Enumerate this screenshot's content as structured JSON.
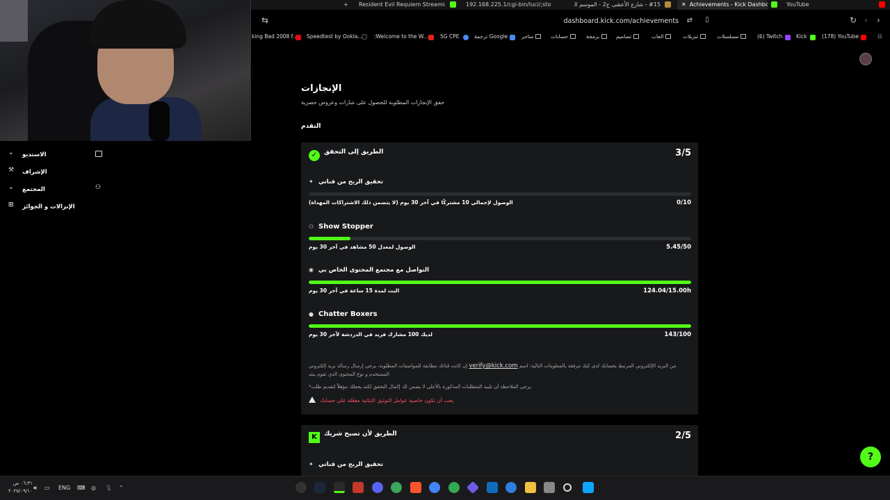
{
  "tabs": [
    {
      "label": "+"
    },
    {
      "label": "Resident Evil Requiem Streaming - Li"
    },
    {
      "label": "192.168.225.1/cgi-bin/luci/;stok=6c4"
    },
    {
      "label": "#15 - شارع الأعشى ج2 - الموسم الثاني"
    },
    {
      "label": "Achievements - Kick Dashboard"
    },
    {
      "label": "YouTube"
    }
  ],
  "address": {
    "url": "dashboard.kick.com/achievements"
  },
  "bookmarks": [
    "king Bad 2008 f...",
    "Speedtest by Ookla...",
    ":Welcome to the W...",
    "5G CPE",
    "Google ترجمة",
    "متاجر",
    "حسابات",
    "برمجة",
    "تصاميم",
    "العاب",
    "تنزيلات",
    "مسلسلات",
    "(6) Twitch",
    "Kick",
    "(178) YouTube"
  ],
  "sidebar": {
    "items": [
      {
        "label": "الاستديو",
        "chevron": true
      },
      {
        "label": "الإشراف",
        "chevron": false
      },
      {
        "label": "المجتمع",
        "chevron": true
      },
      {
        "label": "الإنزالات و الجوائز",
        "chevron": false
      }
    ]
  },
  "page": {
    "title": "الإنجازات",
    "subtitle": "حقق الإنجازات المطلوبة للحصول على شارات وعروض حصرية",
    "progress_heading": "التقدم"
  },
  "card1": {
    "title": "الطريق إلى التحقق",
    "count": "3/5",
    "achievements": [
      {
        "name": "تحقيق الربح من قناتي",
        "desc": "الوصول لإجمالي 10 مشتركًا في آخر 30 يوم (لا يتضمن ذلك الاشتراكات المهداة)",
        "value": "0/10",
        "progress": 0
      },
      {
        "name": "Show Stopper",
        "desc": "الوصول لمعدل 50 مشاهد في آخر 30 يوم",
        "value": "5.45/50",
        "progress": 0.109
      },
      {
        "name": "التواصل مع مجتمع المحتوى الخاص بي",
        "desc": "البث لمدة 15 ساعة في آخر 30 يوم",
        "value": "124.04/15.00h",
        "progress": 1
      },
      {
        "name": "Chatter Boxers",
        "desc": "لديك 100 مشارك فريد في الدردشة لآخر 30 يوم",
        "value": "143/100",
        "progress": 1
      }
    ],
    "note1_pre": "إن كانت قناتك مطابقة للمواصفات المطلوبة، يرجى إرسال رسالة بريد إلكتروني",
    "note1_email": "verify@kick.com",
    "note1_post": "من البريد الإلكتروني المرتبط بحسابك لدى كيك مرفقة بالمعلومات التالية: اسم المستخدم و نوع المحتوى الذي تقوم ببثه",
    "note2": "*يرجى الملاحظة أن تلبية المتطلبات المذكورة بالأعلى لا يضمن لك إكمال التحقق لكنه يجعلك مؤهلاً لتقديم طلب",
    "warning": "يجب أن تكون خاصية عوامل التوثيق الثنائية مفعّلة على حسابك"
  },
  "card2": {
    "title": "الطريق لأن تصبح شريك",
    "count": "2/5",
    "first_achievement": "تحقيق الربح من قناتي"
  },
  "taskbar": {
    "lang": "ENG",
    "time": "٠٦:٣١ ص",
    "date": "٢٠٢٥/٠٩/١٠"
  },
  "colors": {
    "accent": "#53fc18",
    "card": "#18191b",
    "warning": "#ff4d5e"
  }
}
